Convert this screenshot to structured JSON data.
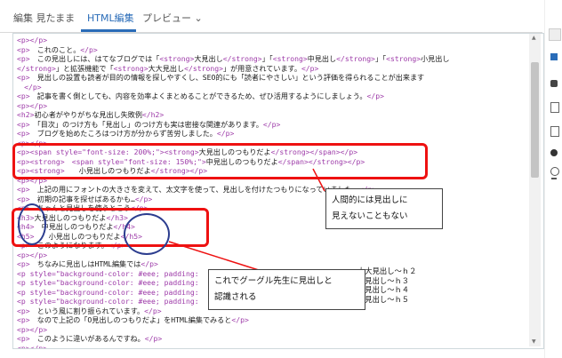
{
  "tabs": [
    {
      "label": "編集 見たまま"
    },
    {
      "label": "HTML編集"
    },
    {
      "label": "プレビュー ⌄"
    }
  ],
  "tab_extra_icon": "chevron-down-icon",
  "code_lines": [
    "<p></p>",
    "<p>　これのこと。</p>",
    "<p>　この見出しには、はてなブログでは「<strong>大見出し</strong>」「<strong>中見出し</strong>」「<strong>小見出し",
    "</strong>」と拡張機能で「<strong>大大見出し</strong>」が用意されています。</p>",
    "<p>　見出しの設置も読者が目的の情報を探しやすくし、SEO的にも「読者にやさしい」という評価を得られることが出来ます",
    "　</p>",
    "<p>　記事を書く側としても、内容を効率よくまとめることができるため、ぜひ活用するようにしましょう。</p>",
    "<p></p>",
    "<h2>初心者がやりがちな見出し失敗例</h2>",
    "<p>　「目次」のつけ方も「見出し」のつけ方も実は密接な関連があります。</p>",
    "<p>　ブログを始めたころはつけ方が分からず苦労しました。</p>",
    "<p></p>",
    "<p><span style=\"font-size: 200%;\"><strong>大見出しのつもりだよ</strong></span></p>",
    "<p><strong>　<span style=\"font-size: 150%;\">中見出しのつもりだよ</span></strong></p>",
    "<p><strong>　　小見出しのつもりだよ</strong></p>",
    "<p></p>",
    "<p>　上記の用にフォントの大きさを変えて、太文字を使って、見出しを付けたつもりになっていました。</p>",
    "<p>　初期の記事を探せばあるかも…</p>",
    "<p>　ちゃんと見出しを使うとこう</p>",
    "<h3>大見出しのつもりだよ</h3>",
    "<h4>　中見出しのつもりだよ</h4>",
    "<h5>　　小見出しのつもりだよ</h5>",
    "<p>　このようになります。</p>",
    "<p></p>",
    "<p>　ちなみに見出しはHTML編集では</p>",
    "<p style=\"background-color: #eee; padding:",
    "<p style=\"background-color: #eee; padding:",
    "<p style=\"background-color: #eee; padding:",
    "<p style=\"background-color: #eee; padding:",
    "<p>　という風に割り振られています。</p>",
    "<p>　なので上記の「O見出しのつもりだよ」をHTML編集でみると</p>",
    "<p></p>",
    "<p>　このように違いがあるんですね。</p>",
    "<p></p>"
  ],
  "heading_map": [
    "大大見出し～ｈ２",
    "大見出し～ｈ３",
    "中見出し～ｈ４",
    "小見出し～ｈ５"
  ],
  "callouts": {
    "human": "人間的には見出しに\n見えないこともない",
    "google": "これでグーグル先生に見出しと\n認識される"
  },
  "colors": {
    "accent": "#2a6cb8",
    "highlight": "#e11111",
    "tag": "#9d3aa8",
    "oval": "#2c3d8f"
  },
  "side_icons": [
    "tools-icon",
    "square-icon",
    "puzzle-icon",
    "document-icon",
    "document-icon",
    "circle-icon",
    "clock-icon",
    "pin-icon"
  ]
}
